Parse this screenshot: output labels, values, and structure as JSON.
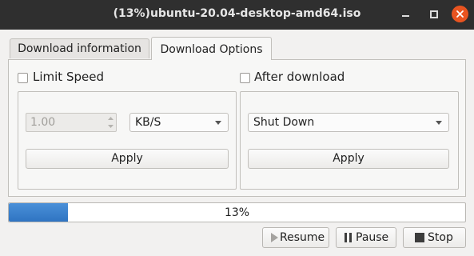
{
  "window": {
    "title": "(13%)ubuntu-20.04-desktop-amd64.iso"
  },
  "tabs": [
    {
      "label": "Download information"
    },
    {
      "label": "Download Options"
    }
  ],
  "limit_speed": {
    "label": "Limit Speed",
    "checked": false,
    "value": "1.00",
    "unit": "KB/S",
    "apply_label": "Apply"
  },
  "after_download": {
    "label": "After download",
    "checked": false,
    "action": "Shut Down",
    "apply_label": "Apply"
  },
  "progress": {
    "percent": 13,
    "label": "13%"
  },
  "actions": {
    "resume_label": "Resume",
    "pause_label": "Pause",
    "stop_label": "Stop"
  }
}
